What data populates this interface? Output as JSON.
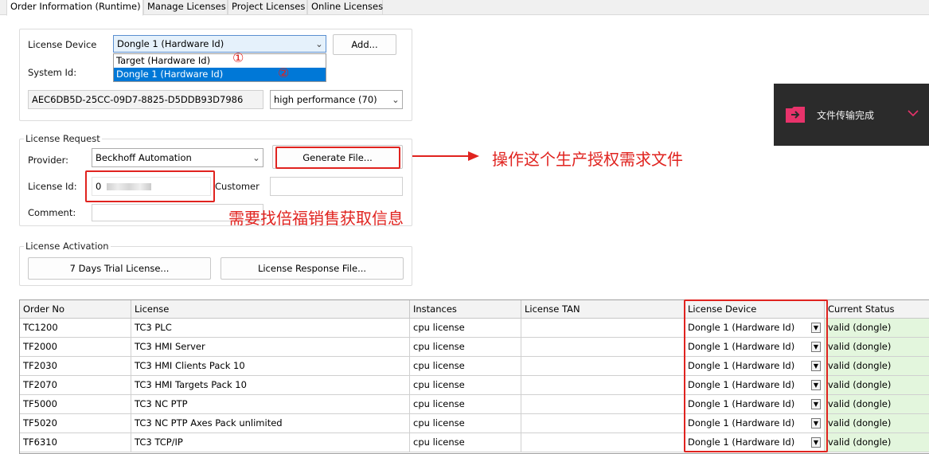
{
  "tabs": [
    {
      "label": "Order Information (Runtime)",
      "active": true
    },
    {
      "label": "Manage Licenses",
      "active": false
    },
    {
      "label": "Project Licenses",
      "active": false
    },
    {
      "label": "Online Licenses",
      "active": false
    }
  ],
  "device": {
    "label": "License Device",
    "selected": "Dongle 1 (Hardware Id)",
    "add_button": "Add...",
    "options": [
      "Target (Hardware Id)",
      "Dongle 1 (Hardware Id)"
    ],
    "system_id_label": "System Id:",
    "system_id_value": "AEC6DB5D-25CC-09D7-8825-D5DDB93D7986",
    "performance": "high performance (70)"
  },
  "request": {
    "legend": "License Request",
    "provider_label": "Provider:",
    "provider_value": "Beckhoff Automation",
    "generate_button": "Generate File...",
    "license_id_label": "License Id:",
    "license_id_value": "0",
    "customer_label": "Customer",
    "customer_value": "",
    "comment_label": "Comment:",
    "comment_value": ""
  },
  "activation": {
    "legend": "License Activation",
    "trial_button": "7 Days Trial License...",
    "response_button": "License Response File..."
  },
  "annotations": {
    "marker_1": "①",
    "marker_2": "②",
    "generate_note": "操作这个生产授权需求文件",
    "license_id_note": "需要找倍福销售获取信息"
  },
  "toast": {
    "text": "文件传输完成",
    "icon": "arrow-right-icon",
    "accent": "#e8336b"
  },
  "grid": {
    "headers": [
      "Order No",
      "License",
      "Instances",
      "License TAN",
      "License Device",
      "Current Status"
    ],
    "rows": [
      [
        "TC1200",
        "TC3 PLC",
        "cpu license",
        "",
        "Dongle 1 (Hardware Id)",
        "valid (dongle)"
      ],
      [
        "TF2000",
        "TC3 HMI Server",
        "cpu license",
        "",
        "Dongle 1 (Hardware Id)",
        "valid (dongle)"
      ],
      [
        "TF2030",
        "TC3 HMI Clients Pack 10",
        "cpu license",
        "",
        "Dongle 1 (Hardware Id)",
        "valid (dongle)"
      ],
      [
        "TF2070",
        "TC3 HMI Targets Pack 10",
        "cpu license",
        "",
        "Dongle 1 (Hardware Id)",
        "valid (dongle)"
      ],
      [
        "TF5000",
        "TC3 NC PTP",
        "cpu license",
        "",
        "Dongle 1 (Hardware Id)",
        "valid (dongle)"
      ],
      [
        "TF5020",
        "TC3 NC PTP Axes Pack unlimited",
        "cpu license",
        "",
        "Dongle 1 (Hardware Id)",
        "valid (dongle)"
      ],
      [
        "TF6310",
        "TC3 TCP/IP",
        "cpu license",
        "",
        "Dongle 1 (Hardware Id)",
        "valid (dongle)"
      ]
    ]
  },
  "colors": {
    "annotation_red": "#e0231f",
    "status_valid_bg": "#e3f6dd",
    "selection_blue": "#0078d7"
  }
}
